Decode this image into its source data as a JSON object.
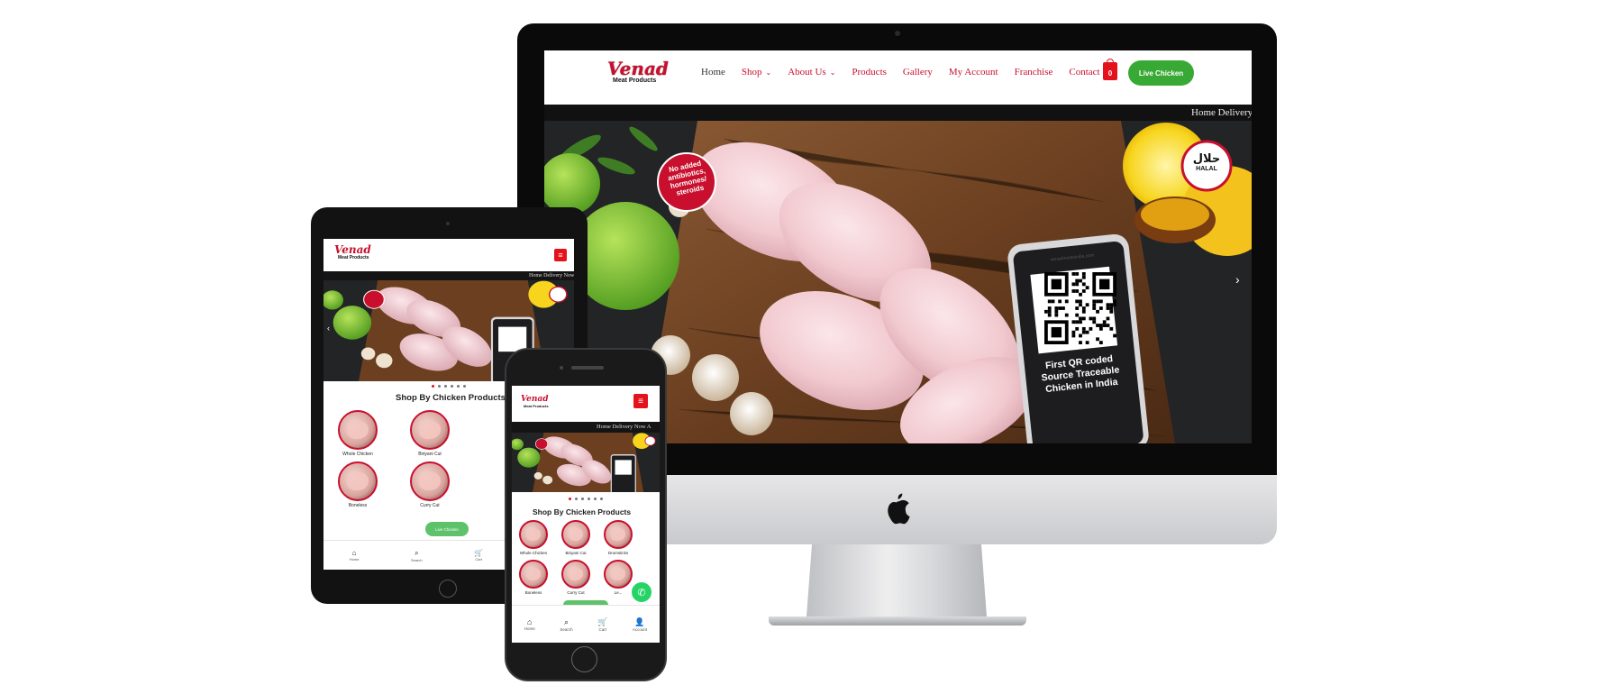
{
  "site": {
    "brand_name": "Venad",
    "brand_sub": "Meat Products",
    "nav": [
      {
        "label": "Home",
        "dropdown": false,
        "active": true
      },
      {
        "label": "Shop",
        "dropdown": true,
        "active": false
      },
      {
        "label": "About Us",
        "dropdown": true,
        "active": false
      },
      {
        "label": "Products",
        "dropdown": false,
        "active": false
      },
      {
        "label": "Gallery",
        "dropdown": false,
        "active": false
      },
      {
        "label": "My Account",
        "dropdown": false,
        "active": false
      },
      {
        "label": "Franchise",
        "dropdown": false,
        "active": false
      },
      {
        "label": "Contact Us",
        "dropdown": false,
        "active": false
      }
    ],
    "cart_count": "0",
    "cta_label": "Live Chicken",
    "ticker": "Home Delivery Now",
    "ticker_short": "Home Delivery Now A"
  },
  "hero": {
    "badge_text": [
      "No added",
      "antibiotics,",
      "hormones/",
      "steroids"
    ],
    "halal_arabic": "حلال",
    "halal_label": "HALAL",
    "phone_url": "venadmeatsindia.com",
    "qr_caption": [
      "First QR coded",
      "Source Traceable",
      "Chicken in India"
    ]
  },
  "shop": {
    "title": "Shop By Chicken Products",
    "tablet_categories": [
      "Whole Chicken",
      "Biriyani Cut",
      "Boneless",
      "Curry Cut"
    ],
    "phone_categories": [
      "Whole Chicken",
      "Biriyani Cut",
      "Drumsticks",
      "Boneless",
      "Curry Cut",
      "Le..."
    ],
    "live_label": "Live Chicken"
  },
  "bottom_nav": [
    {
      "label": "Home",
      "icon": "home-icon"
    },
    {
      "label": "Search",
      "icon": "search-icon"
    },
    {
      "label": "Cart",
      "icon": "cart-icon"
    },
    {
      "label": "Account",
      "icon": "account-icon"
    }
  ],
  "colors": {
    "brand_red": "#c8102e",
    "cta_green": "#39a935",
    "whatsapp_green": "#25d366"
  }
}
